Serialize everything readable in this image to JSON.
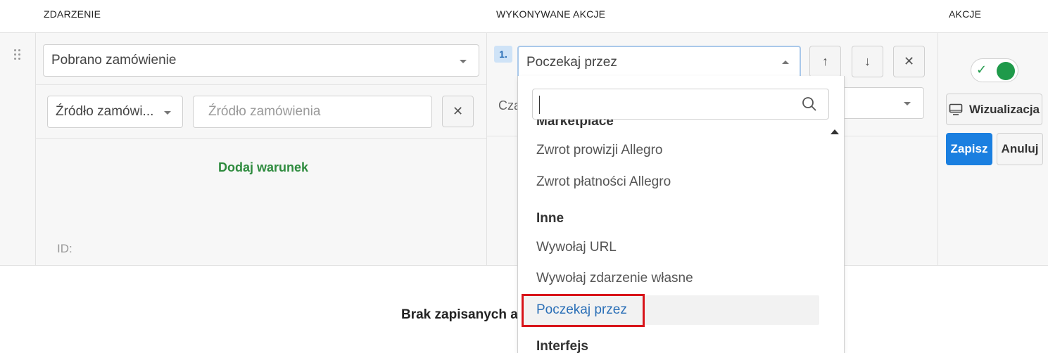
{
  "header": {
    "col_event": "ZDARZENIE",
    "col_actions": "WYKONYWANE AKCJE",
    "col_controls": "AKCJE"
  },
  "event": {
    "selected": "Pobrano zamówienie",
    "condition_field": "Źródło zamówi...",
    "condition_value_placeholder": "Źródło zamówienia",
    "add_condition": "Dodaj warunek",
    "id_label": "ID:"
  },
  "action": {
    "number": "1.",
    "selected": "Poczekaj przez",
    "param_label": "Cza"
  },
  "controls": {
    "visualize": "Wizualizacja",
    "save": "Zapisz",
    "cancel": "Anuluj",
    "accent_color": "#1a7fe0",
    "toggle_on_color": "#1f9a4a"
  },
  "dropdown": {
    "search_value": "",
    "items": [
      {
        "type": "group",
        "label": "Marketplace"
      },
      {
        "type": "option",
        "label": "Zwrot prowizji Allegro"
      },
      {
        "type": "option",
        "label": "Zwrot płatności Allegro"
      },
      {
        "type": "group",
        "label": "Inne"
      },
      {
        "type": "option",
        "label": "Wywołaj URL"
      },
      {
        "type": "option",
        "label": "Wywołaj zdarzenie własne"
      },
      {
        "type": "option",
        "label": "Poczekaj przez",
        "selected": true
      },
      {
        "type": "group",
        "label": "Interfejs"
      }
    ]
  },
  "footer": {
    "empty_message": "Brak zapisanych a"
  }
}
